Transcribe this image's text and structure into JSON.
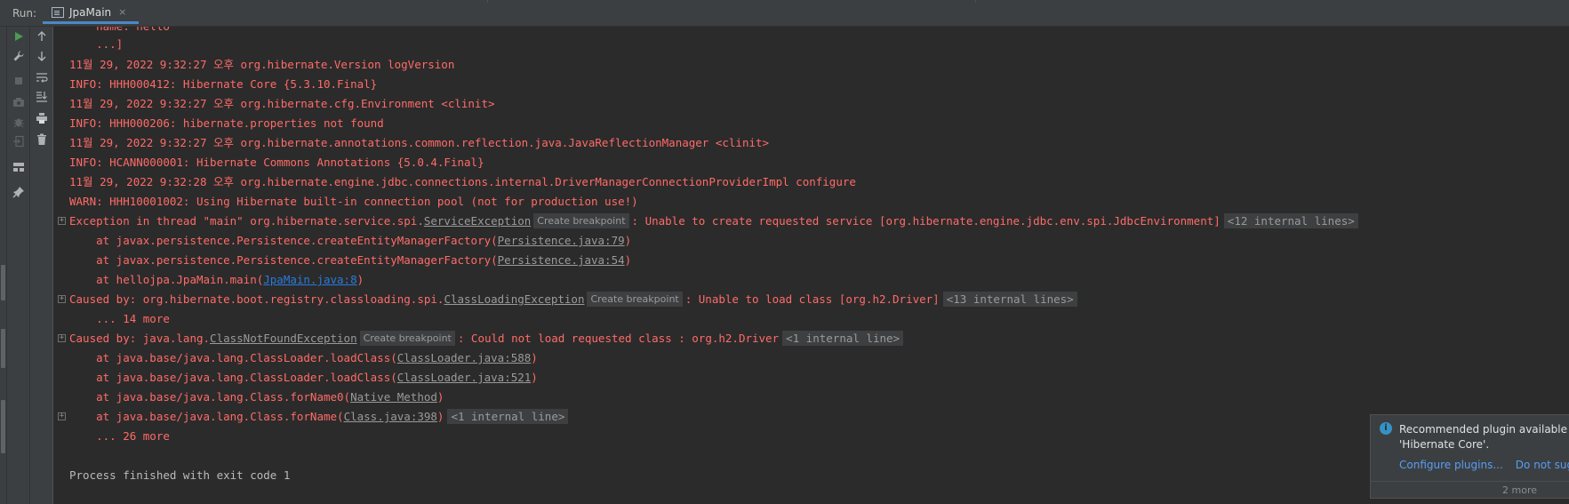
{
  "header": {
    "run_label": "Run:",
    "tab_label": "JpaMain",
    "tab_close": "×"
  },
  "icons": {
    "rerun": "play-icon",
    "settings": "wrench-icon",
    "stop": "stop-icon",
    "dump": "camera-icon",
    "debug": "bug-icon",
    "exit": "exit-icon",
    "layout": "layout-icon",
    "pin": "pin-icon",
    "up": "arrow-up-icon",
    "down": "arrow-down-icon",
    "wrap": "soft-wrap-icon",
    "scroll": "scroll-to-end-icon",
    "print": "print-icon",
    "trash": "trash-icon"
  },
  "colors": {
    "error": "#ff6b68",
    "link_blue": "#287bde",
    "accent": "#4a88c7"
  },
  "console": {
    "l0": "    name: hello",
    "l1": "    ...]",
    "l2": "11월 29, 2022 9:32:27 오후 org.hibernate.Version logVersion",
    "l3": "INFO: HHH000412: Hibernate Core {5.3.10.Final}",
    "l4": "11월 29, 2022 9:32:27 오후 org.hibernate.cfg.Environment <clinit>",
    "l5": "INFO: HHH000206: hibernate.properties not found",
    "l6": "11월 29, 2022 9:32:27 오후 org.hibernate.annotations.common.reflection.java.JavaReflectionManager <clinit>",
    "l7": "INFO: HCANN000001: Hibernate Commons Annotations {5.0.4.Final}",
    "l8": "11월 29, 2022 9:32:28 오후 org.hibernate.engine.jdbc.connections.internal.DriverManagerConnectionProviderImpl configure",
    "l9": "WARN: HHH10001002: Using Hibernate built-in connection pool (not for production use!)",
    "l10": {
      "pre": "Exception in thread \"main\" org.hibernate.service.spi.",
      "link": "ServiceException",
      "badge": "Create breakpoint",
      "post": ": Unable to create requested service [org.hibernate.engine.jdbc.env.spi.JdbcEnvironment]",
      "internal": "<12 internal lines>"
    },
    "l11": {
      "pre": "    at javax.persistence.Persistence.createEntityManagerFactory(",
      "link": "Persistence.java:79",
      "post": ")"
    },
    "l12": {
      "pre": "    at javax.persistence.Persistence.createEntityManagerFactory(",
      "link": "Persistence.java:54",
      "post": ")"
    },
    "l13": {
      "pre": "    at hellojpa.JpaMain.main(",
      "link": "JpaMain.java:8",
      "post": ")"
    },
    "l14": {
      "pre": "Caused by: org.hibernate.boot.registry.classloading.spi.",
      "link": "ClassLoadingException",
      "badge": "Create breakpoint",
      "post": ": Unable to load class [org.h2.Driver]",
      "internal": "<13 internal lines>"
    },
    "l15": "    ... 14 more",
    "l16": {
      "pre": "Caused by: java.lang.",
      "link": "ClassNotFoundException",
      "badge": "Create breakpoint",
      "post": ": Could not load requested class : org.h2.Driver",
      "internal": "<1 internal line>"
    },
    "l17": {
      "pre": "    at java.base/java.lang.ClassLoader.loadClass(",
      "link": "ClassLoader.java:588",
      "post": ")"
    },
    "l18": {
      "pre": "    at java.base/java.lang.ClassLoader.loadClass(",
      "link": "ClassLoader.java:521",
      "post": ")"
    },
    "l19": {
      "pre": "    at java.base/java.lang.Class.forName0(",
      "link": "Native Method",
      "post": ")"
    },
    "l20": {
      "pre": "    at java.base/java.lang.Class.forName(",
      "link": "Class.java:398",
      "post": ")",
      "internal": "<1 internal line>"
    },
    "l21": "    ... 26 more",
    "l22": "Process finished with exit code 1"
  },
  "notification": {
    "title_line1": "Recommended plugin available for",
    "title_line2": "'Hibernate Core'.",
    "action_configure": "Configure plugins...",
    "action_dismiss": "Do not sugge",
    "more": "2 more"
  }
}
